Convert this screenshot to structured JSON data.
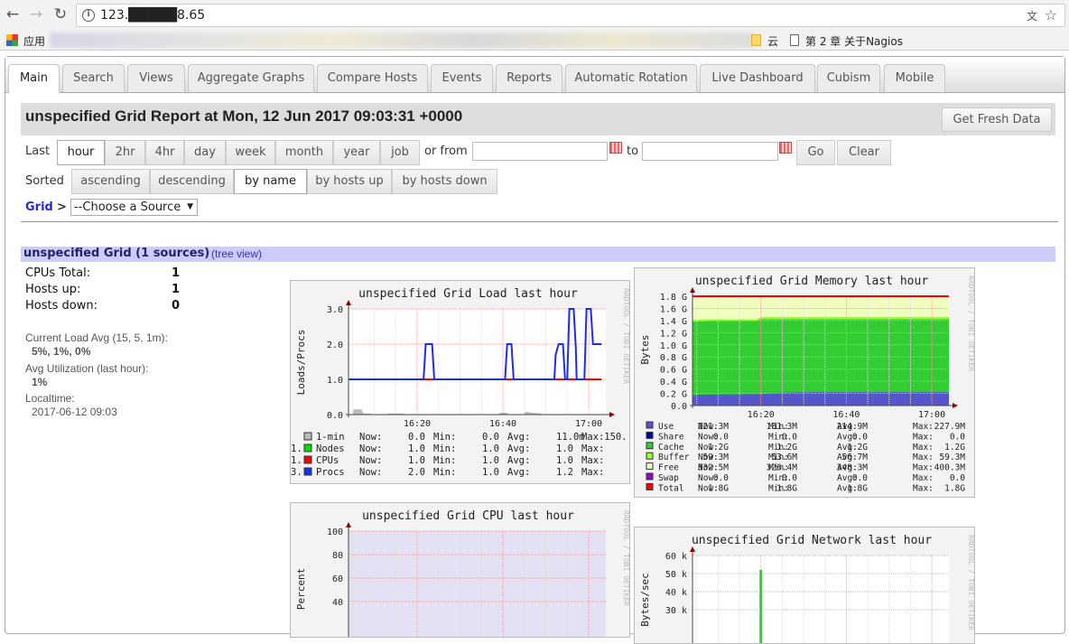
{
  "browser": {
    "url": "123.█████8.65",
    "bookmarks": {
      "apps": "应用",
      "cloud": "云",
      "nagios": "第 2 章 关于Nagios"
    }
  },
  "tabs": [
    "Main",
    "Search",
    "Views",
    "Aggregate Graphs",
    "Compare Hosts",
    "Events",
    "Reports",
    "Automatic Rotation",
    "Live Dashboard",
    "Cubism",
    "Mobile"
  ],
  "header": {
    "title": "unspecified Grid Report at Mon, 12 Jun 2017 09:03:31 +0000",
    "fresh_button": "Get Fresh Data"
  },
  "range": {
    "last_label": "Last",
    "options": [
      "hour",
      "2hr",
      "4hr",
      "day",
      "week",
      "month",
      "year",
      "job"
    ],
    "selected": "hour",
    "or_from": "or from",
    "to": "to",
    "from_value": "",
    "to_value": "",
    "go": "Go",
    "clear": "Clear"
  },
  "sort": {
    "label": "Sorted",
    "options": [
      "ascending",
      "descending",
      "by name",
      "by hosts up",
      "by hosts down"
    ],
    "selected": "by name"
  },
  "breadcrumb": {
    "grid": "Grid",
    "sep": ">",
    "source_select": "--Choose a Source"
  },
  "grid": {
    "title": "unspecified Grid (1 sources)",
    "tree_link": "(tree view)",
    "stats": [
      {
        "label": "CPUs Total:",
        "value": "1"
      },
      {
        "label": "Hosts up:",
        "value": "1"
      },
      {
        "label": "Hosts down:",
        "value": "0"
      }
    ],
    "load_avg_label": "Current Load Avg (15, 5, 1m):",
    "load_avg_value": "5%, 1%, 0%",
    "util_label": "Avg Utilization (last hour):",
    "util_value": "1%",
    "localtime_label": "Localtime:",
    "localtime_value": "2017-06-12 09:03"
  },
  "chart_data": [
    {
      "type": "line",
      "title": "unspecified Grid Load last hour",
      "ylabel": "Loads/Procs",
      "watermark": "RRDTOOL / TOBI OETIKER",
      "xlim": [
        "16:04",
        "17:04"
      ],
      "xticks": [
        "16:20",
        "16:40",
        "17:00"
      ],
      "ylim": [
        0,
        3
      ],
      "yticks": [
        "0.0",
        "1.0",
        "2.0",
        "3.0"
      ],
      "grid": true,
      "series": [
        {
          "name": "1-min",
          "color": "#bbbbbb",
          "kind": "area",
          "points": [
            [
              "16:04",
              0
            ],
            [
              "16:05",
              0
            ],
            [
              "16:05.2",
              0.15
            ],
            [
              "16:07",
              0.15
            ],
            [
              "16:07.5",
              0.03
            ],
            [
              "16:09",
              0.03
            ],
            [
              "16:09.5",
              0
            ],
            [
              "16:13",
              0
            ],
            [
              "16:13.2",
              0.03
            ],
            [
              "16:17",
              0.03
            ],
            [
              "16:17.2",
              0
            ],
            [
              "16:39",
              0
            ],
            [
              "16:39.2",
              0.05
            ],
            [
              "16:41",
              0.05
            ],
            [
              "16:41.2",
              0
            ],
            [
              "16:45",
              0
            ],
            [
              "16:45.2",
              0.08
            ],
            [
              "16:47",
              0.05
            ],
            [
              "16:49",
              0.03
            ],
            [
              "16:49.2",
              0
            ],
            [
              "17:03",
              0
            ]
          ],
          "legend": [
            "Now:",
            "0.0",
            "Min:",
            "0.0",
            "Avg:",
            "11.0m",
            "Max:150."
          ]
        },
        {
          "name": "Nodes",
          "color": "#00dd00",
          "kind": "line",
          "points": [],
          "legend": [
            "Now:",
            "1.0",
            "Min:",
            "1.0",
            "Avg:",
            "1.0",
            "Max:",
            "1."
          ]
        },
        {
          "name": "CPUs",
          "color": "#ff0000",
          "kind": "line",
          "points": [
            [
              "16:04",
              1
            ],
            [
              "17:03",
              1
            ]
          ],
          "legend": [
            "Now:",
            "1.0",
            "Min:",
            "1.0",
            "Avg:",
            "1.0",
            "Max:",
            "1."
          ]
        },
        {
          "name": "Procs",
          "color": "#1a2cf0",
          "kind": "line",
          "points": [
            [
              "16:04",
              1
            ],
            [
              "16:21.5",
              1
            ],
            [
              "16:22",
              2
            ],
            [
              "16:23.5",
              2
            ],
            [
              "16:24",
              1
            ],
            [
              "16:40.5",
              1
            ],
            [
              "16:41",
              2
            ],
            [
              "16:42",
              2
            ],
            [
              "16:42.5",
              1
            ],
            [
              "16:52",
              1
            ],
            [
              "16:52.3",
              1.7
            ],
            [
              "16:53",
              2
            ],
            [
              "16:54",
              2
            ],
            [
              "16:54.5",
              1
            ],
            [
              "16:55",
              1
            ],
            [
              "16:55.5",
              3
            ],
            [
              "16:56.5",
              3
            ],
            [
              "16:57",
              1.9
            ],
            [
              "16:57.2",
              1
            ],
            [
              "16:59",
              1
            ],
            [
              "16:59.5",
              3
            ],
            [
              "17:00.5",
              3
            ],
            [
              "17:01",
              2
            ],
            [
              "17:03",
              2
            ]
          ],
          "legend": [
            "Now:",
            "2.0",
            "Min:",
            "1.0",
            "Avg:",
            "1.2",
            "Max:",
            "3."
          ]
        }
      ]
    },
    {
      "type": "area",
      "title": "unspecified Grid Memory last hour",
      "ylabel": "Bytes",
      "watermark": "RRDTOOL / TOBI OETIKER",
      "xlim": [
        "16:04",
        "17:04"
      ],
      "xticks": [
        "16:20",
        "16:40",
        "17:00"
      ],
      "ylim": [
        0,
        1.8
      ],
      "yticks": [
        "0.0",
        "0.2 G",
        "0.4 G",
        "0.6 G",
        "0.8 G",
        "1.0 G",
        "1.2 G",
        "1.4 G",
        "1.6 G",
        "1.8 G"
      ],
      "grid": true,
      "stacked_bands": [
        {
          "name": "Use",
          "color": "#5555cc",
          "top": [
            [
              "16:04",
              0.17
            ],
            [
              "16:07",
              0.18
            ],
            [
              "16:20",
              0.19
            ],
            [
              "16:25",
              0.21
            ],
            [
              "16:30",
              0.22
            ],
            [
              "17:03",
              0.22
            ]
          ]
        },
        {
          "name": "Cache",
          "color": "#33cc33",
          "top": [
            [
              "16:04",
              1.38
            ],
            [
              "16:08",
              1.39
            ],
            [
              "16:19",
              1.39
            ],
            [
              "16:20",
              1.42
            ],
            [
              "17:03",
              1.42
            ]
          ]
        },
        {
          "name": "Buffer",
          "color": "#99ff33",
          "top": [
            [
              "16:04",
              1.41
            ],
            [
              "16:08",
              1.42
            ],
            [
              "16:19",
              1.42
            ],
            [
              "16:20",
              1.46
            ],
            [
              "17:03",
              1.46
            ]
          ]
        },
        {
          "name": "Free",
          "color": "#f0ffc0",
          "top": [
            [
              "16:04",
              1.8
            ],
            [
              "17:03",
              1.8
            ]
          ]
        }
      ],
      "total_line": {
        "name": "Total",
        "color": "#ff0000",
        "value": 1.8
      },
      "legend": [
        {
          "name": "Use",
          "color": "#5555cc",
          "now": "221.3M",
          "min": "181.3M",
          "avg": "214.9M",
          "max": "227.9M"
        },
        {
          "name": "Share",
          "color": "#0000aa",
          "now": "0.0",
          "min": "0.0",
          "avg": "0.0",
          "max": "0.0"
        },
        {
          "name": "Cache",
          "color": "#33cc33",
          "now": "1.2G",
          "min": "1.2G",
          "avg": "1.2G",
          "max": "1.2G"
        },
        {
          "name": "Buffer",
          "color": "#99ff33",
          "now": "59.3M",
          "min": "53.6M",
          "avg": "56.7M",
          "max": "59.3M"
        },
        {
          "name": "Free",
          "color": "#f0ffc0",
          "now": "332.5M",
          "min": "326.4M",
          "avg": "348.3M",
          "max": "400.3M"
        },
        {
          "name": "Swap",
          "color": "#9900cc",
          "now": "0.0",
          "min": "0.0",
          "avg": "0.0",
          "max": "0.0"
        },
        {
          "name": "Total",
          "color": "#ff0000",
          "now": "1.8G",
          "min": "1.8G",
          "avg": "1.8G",
          "max": "1.8G"
        }
      ]
    },
    {
      "type": "area",
      "title": "unspecified Grid CPU last hour",
      "ylabel": "Percent",
      "watermark": "RRDTOOL / TOBI OETIKER",
      "xlim": [
        "16:04",
        "17:04"
      ],
      "ylim": [
        0,
        100
      ],
      "yticks": [
        "40",
        "60",
        "80",
        "100"
      ],
      "grid": true,
      "idle_color": "#e2e2f4",
      "idle_percent": 100
    },
    {
      "type": "area",
      "title": "unspecified Grid Network last hour",
      "ylabel": "Bytes/sec",
      "watermark": "RRDTOOL / TOBI OETIKER",
      "xlim": [
        "16:04",
        "17:04"
      ],
      "ylim": [
        0,
        60000
      ],
      "yticks": [
        "30 k",
        "40 k",
        "50 k",
        "60 k"
      ],
      "grid": true,
      "series": [
        {
          "color": "#33cc33",
          "points": [
            [
              "16:20",
              52000
            ]
          ]
        }
      ]
    }
  ]
}
